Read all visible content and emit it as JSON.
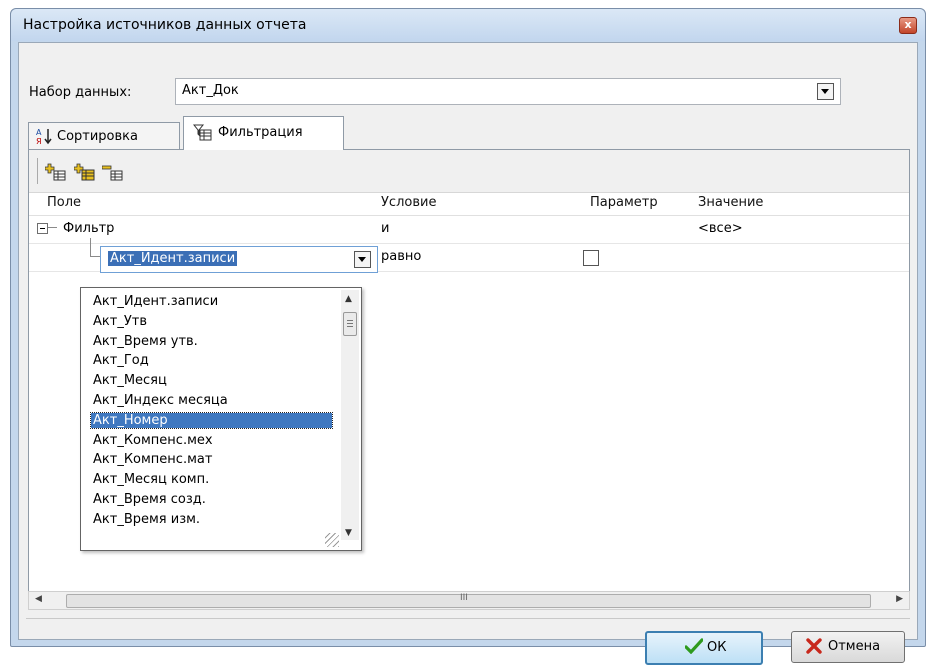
{
  "window": {
    "title": "Настройка источников данных отчета",
    "close_label": "x"
  },
  "dataset": {
    "label": "Набор данных:",
    "value": "Акт_Док"
  },
  "tabs": [
    {
      "label": "Сортировка",
      "icon": "sort-az-icon"
    },
    {
      "label": "Фильтрация",
      "icon": "filter-table-icon",
      "active": true
    }
  ],
  "toolbar": {
    "icons": [
      "add-condition-icon",
      "add-group-icon",
      "remove-condition-icon"
    ]
  },
  "grid": {
    "columns": [
      "Поле",
      "Условие",
      "Параметр",
      "Значение"
    ],
    "rows": [
      {
        "field": "Фильтр",
        "condition": "и",
        "parameter": "",
        "value": "<все>"
      },
      {
        "field": "Акт_Идент.записи",
        "condition": "равно",
        "parameter": false,
        "value": ""
      }
    ]
  },
  "dropdown": {
    "items": [
      "Акт_Идент.записи",
      "Акт_Утв",
      "Акт_Время утв.",
      "Акт_Год",
      "Акт_Месяц",
      "Акт_Индекс месяца",
      "Акт_Номер",
      "Акт_Компенс.мех",
      "Акт_Компенс.мат",
      "Акт_Месяц комп.",
      "Акт_Время созд.",
      "Акт_Время изм."
    ],
    "selected_index": 6
  },
  "scrollbar": {
    "grip_label": "III"
  },
  "buttons": {
    "ok_label": "ОК",
    "cancel_label": "Отмена"
  },
  "colors": {
    "selection": "#3f78c0",
    "titlebar": "#c4d7ec",
    "ok_border": "#3c7fb1"
  }
}
